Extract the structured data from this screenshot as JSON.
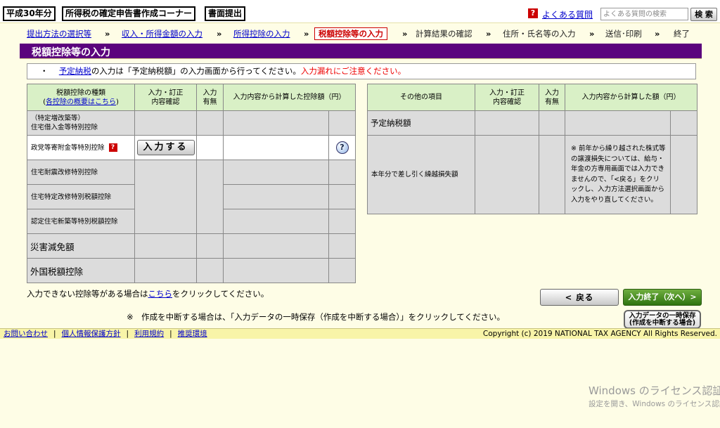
{
  "header": {
    "year_label": "平成30年分",
    "corner_title": "所得税の確定申告書作成コーナー",
    "submit_label": "書面提出",
    "faq_icon": "?",
    "faq_link": "よくある質問",
    "search_placeholder": "よくある質問の検索",
    "search_button": "検 索"
  },
  "breadcrumb": {
    "steps": [
      "提出方法の選択等",
      "収入・所得金額の入力",
      "所得控除の入力",
      "税額控除等の入力",
      "計算結果の確認",
      "住所・氏名等の入力",
      "送信･印刷",
      "終了"
    ],
    "separator": "»"
  },
  "page_title": "税額控除等の入力",
  "notice": {
    "bullet": "・",
    "link": "予定納税",
    "text": "の入力は「予定納税額」の入力画面から行ってください。",
    "warning": "入力漏れにご注意ください。"
  },
  "left_table": {
    "headers": {
      "type": "税額控除の種類",
      "overview_prefix": "(",
      "overview_link": "各控除の概要はこちら",
      "overview_suffix": ")",
      "input_line1": "入力・訂正",
      "input_line2": "内容確認",
      "has_line1": "入力",
      "has_line2": "有無",
      "amount": "入力内容から計算した控除額（円）"
    },
    "rows": [
      "（特定増改築等）住宅借入金等特別控除",
      "政党等寄附金等特別控除",
      "住宅耐震改修特別控除",
      "住宅特定改修特別税額控除",
      "認定住宅新築等特別税額控除",
      "災害減免額",
      "外国税額控除"
    ],
    "row1_line1": "（特定増改築等）",
    "row1_line2": "住宅借入金等特別控除",
    "help_icon": "?",
    "input_button": "入力する",
    "help_circle": "?"
  },
  "right_table": {
    "headers": {
      "item": "その他の項目",
      "input_line1": "入力・訂正",
      "input_line2": "内容確認",
      "has_line1": "入力",
      "has_line2": "有無",
      "amount": "入力内容から計算した額（円）"
    },
    "rows": [
      "予定納税額",
      "本年分で差し引く繰越損失額"
    ],
    "note": "※ 前年から繰り越された株式等の譲渡損失については、給与・年金の方専用画面では入力できませんので、「<戻る」をクリックし、入力方法選択画面から入力をやり直してください。"
  },
  "bottom": {
    "cannot_prefix": "入力できない控除等がある場合は",
    "cannot_link": "こちら",
    "cannot_suffix": "をクリックしてください。",
    "back_button": "< 戻る",
    "next_button": "入力終了（次へ）>",
    "suspend_note": "※　作成を中断する場合は、「入力データの一時保存（作成を中断する場合）」をクリックしてください。",
    "save_line1": "入力データの一時保存",
    "save_line2": "(作成を中断する場合)"
  },
  "footer": {
    "links": [
      "お問い合わせ",
      "個人情報保護方針",
      "利用規約",
      "推奨環境"
    ],
    "separator": "|",
    "copyright": "Copyright (c) 2019 NATIONAL TAX AGENCY All Rights Reserved."
  },
  "watermark": {
    "line1": "Windows のライセンス認証",
    "line2": "設定を開き、Windows のライセンス認証"
  },
  "colors": {
    "title_bar": "#5b037d",
    "header_green": "#d9f0c6",
    "cell_gray": "#dcdcdc",
    "page_bg": "#fefde6",
    "footer_bg": "#f8f4a8",
    "warning_red": "#e00000"
  }
}
